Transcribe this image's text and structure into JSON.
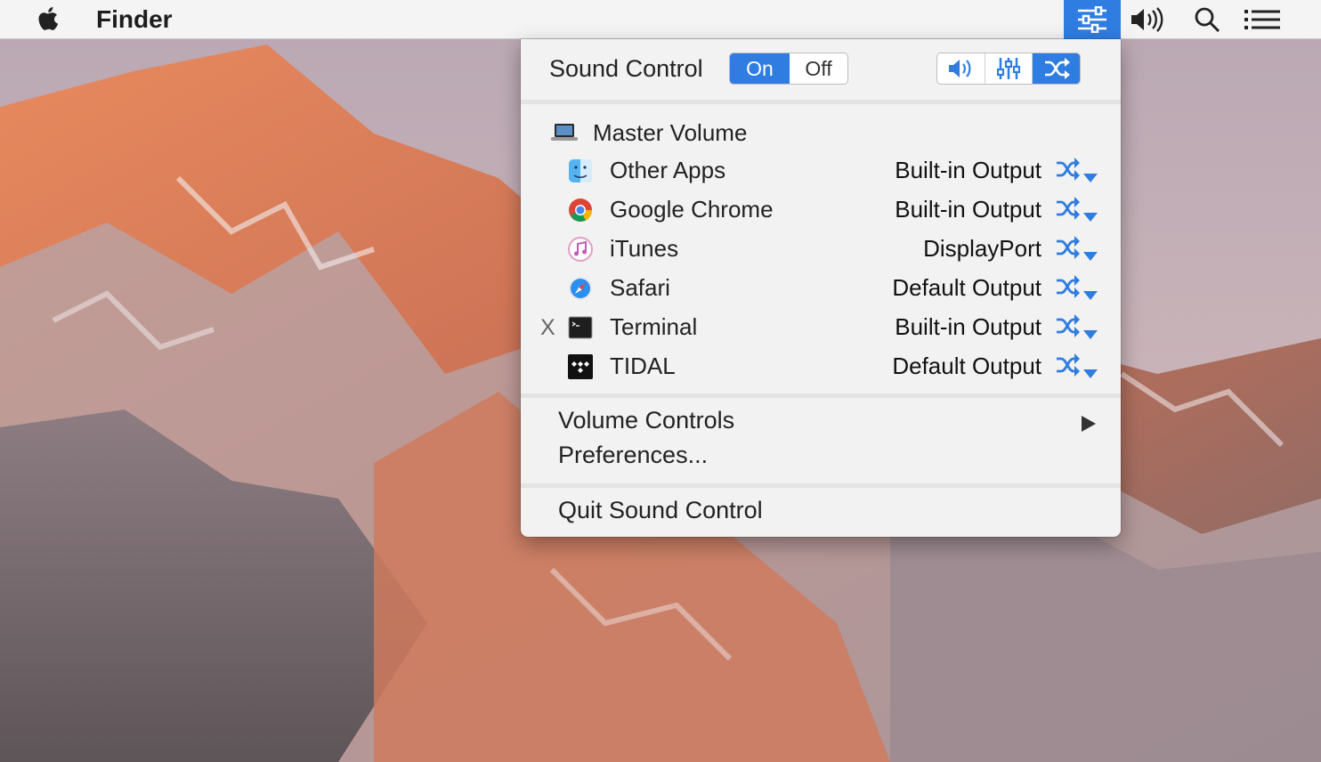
{
  "menubar": {
    "app_name": "Finder"
  },
  "panel": {
    "title": "Sound Control",
    "toggle": {
      "on_label": "On",
      "off_label": "Off",
      "state": "on"
    },
    "modes": [
      "volume-icon",
      "equalizer-icon",
      "output-switch-icon"
    ],
    "active_mode": 2,
    "master": {
      "label": "Master Volume"
    },
    "apps": [
      {
        "name": "Other Apps",
        "device": "Built-in Output",
        "muted_mark": ""
      },
      {
        "name": "Google Chrome",
        "device": "Built-in Output",
        "muted_mark": ""
      },
      {
        "name": "iTunes",
        "device": "DisplayPort",
        "muted_mark": ""
      },
      {
        "name": "Safari",
        "device": "Default Output",
        "muted_mark": ""
      },
      {
        "name": "Terminal",
        "device": "Built-in Output",
        "muted_mark": "X"
      },
      {
        "name": "TIDAL",
        "device": "Default Output",
        "muted_mark": ""
      }
    ],
    "menu": {
      "volume_controls": "Volume Controls",
      "preferences": "Preferences...",
      "quit": "Quit Sound Control"
    }
  },
  "colors": {
    "accent": "#2f7de1",
    "panel_bg": "#f2f2f2",
    "menubar_bg": "#f4f4f4"
  }
}
